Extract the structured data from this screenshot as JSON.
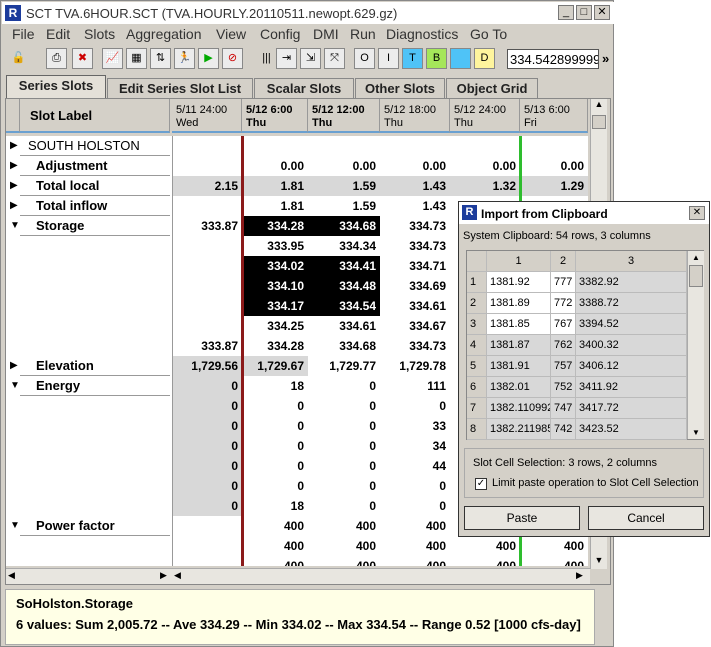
{
  "window": {
    "title": "SCT TVA.6HOUR.SCT (TVA.HOURLY.20110511.newopt.629.gz)",
    "minimize": "_",
    "maximize": "□",
    "close": "✕"
  },
  "menu": [
    "File",
    "Edit",
    "Slots",
    "Aggregation",
    "View",
    "Config",
    "DMI",
    "Run",
    "Diagnostics",
    "Go To"
  ],
  "toolbar": {
    "icons": [
      "lock-icon",
      "print-icon",
      "delete-icon",
      "chart-icon",
      "table-icon",
      "flow-icon",
      "run-icon",
      "play-icon",
      "stop-icon"
    ],
    "boxes": [
      "O",
      "I",
      "T",
      "B",
      "",
      "D"
    ],
    "time_value": "334.542899999",
    "more": "»"
  },
  "tabs": [
    "Series Slots",
    "Edit Series Slot List",
    "Scalar Slots",
    "Other Slots",
    "Object Grid"
  ],
  "grid": {
    "slot_label_header": "Slot Label",
    "columns": [
      {
        "date": "5/11 24:00",
        "day": "Wed",
        "bold": false
      },
      {
        "date": "5/12 6:00",
        "day": "Thu",
        "bold": true
      },
      {
        "date": "5/12 12:00",
        "day": "Thu",
        "bold": true
      },
      {
        "date": "5/12 18:00",
        "day": "Thu",
        "bold": false
      },
      {
        "date": "5/12 24:00",
        "day": "Thu",
        "bold": false
      },
      {
        "date": "5/13 6:00",
        "day": "Fri",
        "bold": false
      }
    ],
    "rows": [
      {
        "label": "SOUTH HOLSTON",
        "expander": "▶",
        "values": [
          "",
          "",
          "",
          "",
          "",
          ""
        ]
      },
      {
        "label": "Adjustment",
        "expander": "▶",
        "values": [
          "",
          "0.00",
          "0.00",
          "0.00",
          "0.00",
          "0.00"
        ]
      },
      {
        "label": "Total local",
        "expander": "▶",
        "values": [
          "2.15",
          "1.81",
          "1.59",
          "1.43",
          "1.32",
          "1.29"
        ]
      },
      {
        "label": "Total inflow",
        "expander": "▶",
        "values": [
          "",
          "1.81",
          "1.59",
          "1.43",
          "",
          ""
        ]
      },
      {
        "label": "Storage",
        "expander": "▼",
        "values": [
          "333.87",
          "334.28",
          "334.68",
          "334.73",
          "",
          ""
        ]
      },
      {
        "label": "",
        "expander": "",
        "values": [
          "",
          "333.95",
          "334.34",
          "334.73",
          "",
          ""
        ]
      },
      {
        "label": "",
        "expander": "",
        "values": [
          "",
          "334.02",
          "334.41",
          "334.71",
          "",
          ""
        ]
      },
      {
        "label": "",
        "expander": "",
        "values": [
          "",
          "334.10",
          "334.48",
          "334.69",
          "",
          ""
        ]
      },
      {
        "label": "",
        "expander": "",
        "values": [
          "",
          "334.17",
          "334.54",
          "334.61",
          "",
          ""
        ]
      },
      {
        "label": "",
        "expander": "",
        "values": [
          "",
          "334.25",
          "334.61",
          "334.67",
          "",
          ""
        ]
      },
      {
        "label": "",
        "expander": "",
        "values": [
          "333.87",
          "334.28",
          "334.68",
          "334.73",
          "",
          ""
        ]
      },
      {
        "label": "Elevation",
        "expander": "▶",
        "values": [
          "1,729.56",
          "1,729.67",
          "1,729.77",
          "1,729.78",
          "",
          ""
        ]
      },
      {
        "label": "Energy",
        "expander": "▼",
        "values": [
          "0",
          "18",
          "0",
          "111",
          "",
          ""
        ]
      },
      {
        "label": "",
        "expander": "",
        "values": [
          "0",
          "0",
          "0",
          "0",
          "",
          ""
        ]
      },
      {
        "label": "",
        "expander": "",
        "values": [
          "0",
          "0",
          "0",
          "33",
          "",
          ""
        ]
      },
      {
        "label": "",
        "expander": "",
        "values": [
          "0",
          "0",
          "0",
          "34",
          "",
          ""
        ]
      },
      {
        "label": "",
        "expander": "",
        "values": [
          "0",
          "0",
          "0",
          "44",
          "",
          ""
        ]
      },
      {
        "label": "",
        "expander": "",
        "values": [
          "0",
          "0",
          "0",
          "0",
          "",
          ""
        ]
      },
      {
        "label": "",
        "expander": "",
        "values": [
          "0",
          "18",
          "0",
          "0",
          "",
          ""
        ]
      },
      {
        "label": "Power factor",
        "expander": "▼",
        "values": [
          "",
          "400",
          "400",
          "400",
          "",
          ""
        ]
      },
      {
        "label": "",
        "expander": "",
        "values": [
          "",
          "400",
          "400",
          "400",
          "400",
          "400"
        ]
      },
      {
        "label": "",
        "expander": "",
        "values": [
          "",
          "400",
          "400",
          "400",
          "400",
          "400"
        ]
      }
    ]
  },
  "status": {
    "line1": "SoHolston.Storage",
    "line2": "6 values:  Sum 2,005.72 -- Ave 334.29 -- Min 334.02 -- Max 334.54 -- Range 0.52 [1000 cfs-day]"
  },
  "dialog": {
    "title": "Import from Clipboard",
    "close": "✕",
    "clipboard_info": "System Clipboard:  54 rows, 3 columns",
    "col_headers": [
      "1",
      "2",
      "3"
    ],
    "rows": [
      [
        "1",
        "1381.92",
        "777",
        "3382.92"
      ],
      [
        "2",
        "1381.89",
        "772",
        "3388.72"
      ],
      [
        "3",
        "1381.85",
        "767",
        "3394.52"
      ],
      [
        "4",
        "1381.87",
        "762",
        "3400.32"
      ],
      [
        "5",
        "1381.91",
        "757",
        "3406.12"
      ],
      [
        "6",
        "1382.01",
        "752",
        "3411.92"
      ],
      [
        "7",
        "1382.110992",
        "747",
        "3417.72"
      ],
      [
        "8",
        "1382.211985",
        "742",
        "3423.52"
      ]
    ],
    "selection_text": "Slot Cell Selection:  3 rows, 2 columns",
    "limit_checkbox_label": "Limit paste operation to Slot Cell Selection",
    "limit_checked": true,
    "paste_label": "Paste",
    "cancel_label": "Cancel"
  }
}
